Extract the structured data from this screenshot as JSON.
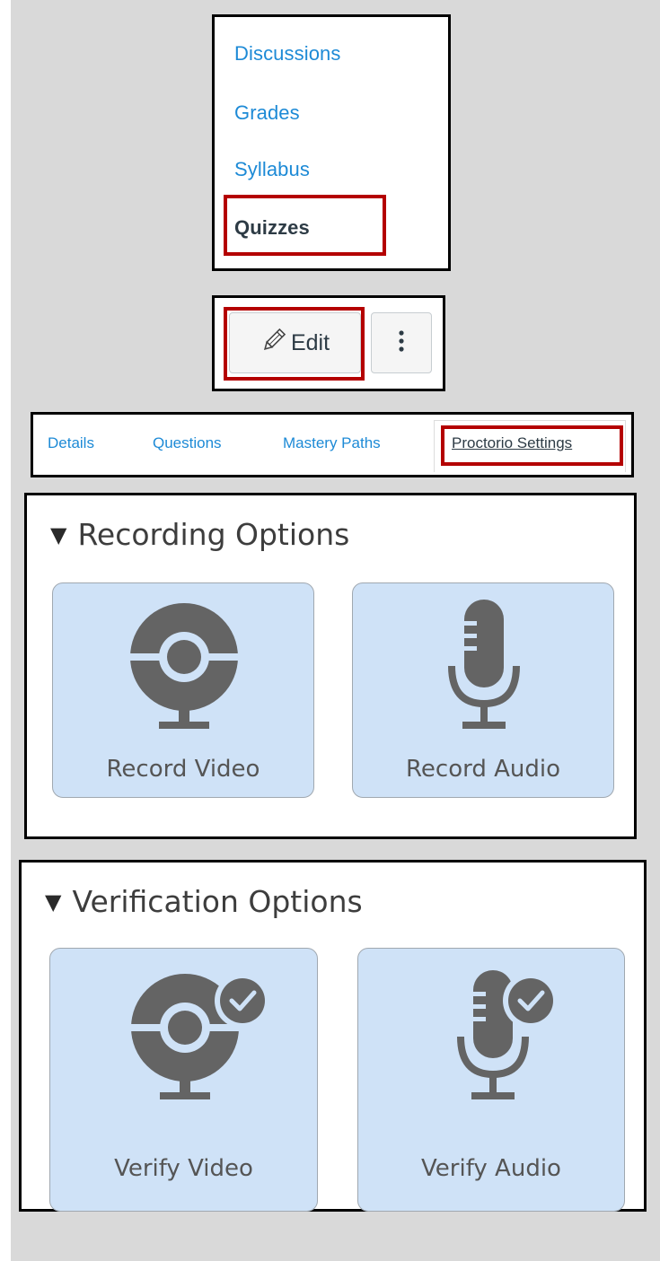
{
  "nav": {
    "items": [
      {
        "label": "Discussions"
      },
      {
        "label": "Grades"
      },
      {
        "label": "Syllabus"
      },
      {
        "label": "Quizzes",
        "active": true
      }
    ]
  },
  "toolbar": {
    "edit_label": "Edit",
    "edit_icon": "pencil-icon",
    "more_icon": "kebab-menu-icon"
  },
  "tabs": [
    {
      "label": "Details"
    },
    {
      "label": "Questions"
    },
    {
      "label": "Mastery Paths"
    },
    {
      "label": "Proctorio Settings",
      "active": true
    }
  ],
  "recording": {
    "title": "Recording Options",
    "cards": [
      {
        "label": "Record Video",
        "icon": "webcam-icon"
      },
      {
        "label": "Record Audio",
        "icon": "microphone-icon"
      }
    ]
  },
  "verification": {
    "title": "Verification Options",
    "cards": [
      {
        "label": "Verify Video",
        "icon": "webcam-check-icon"
      },
      {
        "label": "Verify Audio",
        "icon": "microphone-check-icon"
      }
    ]
  },
  "colors": {
    "link": "#1d8ad6",
    "highlight": "#b40000",
    "card_bg": "#cfe2f7",
    "icon": "#646464"
  }
}
